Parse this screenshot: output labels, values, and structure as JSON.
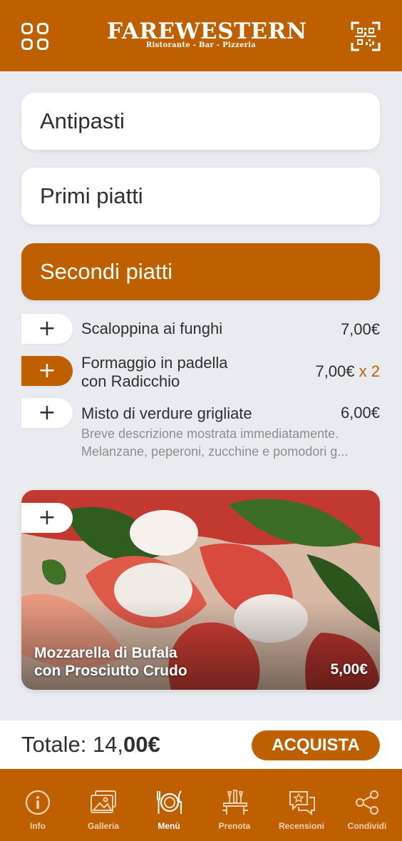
{
  "header": {
    "brand_name": "FAREWESTERN",
    "brand_subtitle": "Ristorante - Bar - Pizzeria",
    "menu_icon": "grid-menu-icon",
    "qr_icon": "qr-code-icon"
  },
  "categories": [
    {
      "label": "Antipasti",
      "active": false
    },
    {
      "label": "Primi piatti",
      "active": false
    },
    {
      "label": "Secondi piatti",
      "active": true
    }
  ],
  "dishes": [
    {
      "name": "Scaloppina ai funghi",
      "price": "7,00€",
      "quantity": "",
      "selected": false
    },
    {
      "name_line1": "Formaggio in padella",
      "name_line2": "con Radicchio",
      "price": "7,00€",
      "quantity": "x 2",
      "selected": true
    },
    {
      "name": "Misto di verdure grigliate",
      "price": "6,00€",
      "quantity": "",
      "desc_line1": "Breve descrizione mostrata immediatamente.",
      "desc_line2": "Melanzane, peperoni, zucchine e pomodori g...",
      "selected": false
    }
  ],
  "add_symbol": "+",
  "featured": {
    "name_line1": "Mozzarella di Bufala",
    "name_line2": "con Prosciutto Crudo",
    "price": "5,00€"
  },
  "cart": {
    "total_label": "Totale: 14,",
    "total_bold": "00€",
    "buy_label": "ACQUISTA"
  },
  "tabs": [
    {
      "label": "Info",
      "icon": "info-icon",
      "active": false
    },
    {
      "label": "Galleria",
      "icon": "gallery-icon",
      "active": false
    },
    {
      "label": "Menù",
      "icon": "plate-cutlery-icon",
      "active": true
    },
    {
      "label": "Prenota",
      "icon": "table-booking-icon",
      "active": false
    },
    {
      "label": "Recensioni",
      "icon": "reviews-icon",
      "active": false
    },
    {
      "label": "Condividi",
      "icon": "share-icon",
      "active": false
    }
  ],
  "colors": {
    "brand": "#bf6000",
    "background": "#e9ebf0",
    "text": "#2f2f2f",
    "muted_text": "#8e8e8e"
  }
}
